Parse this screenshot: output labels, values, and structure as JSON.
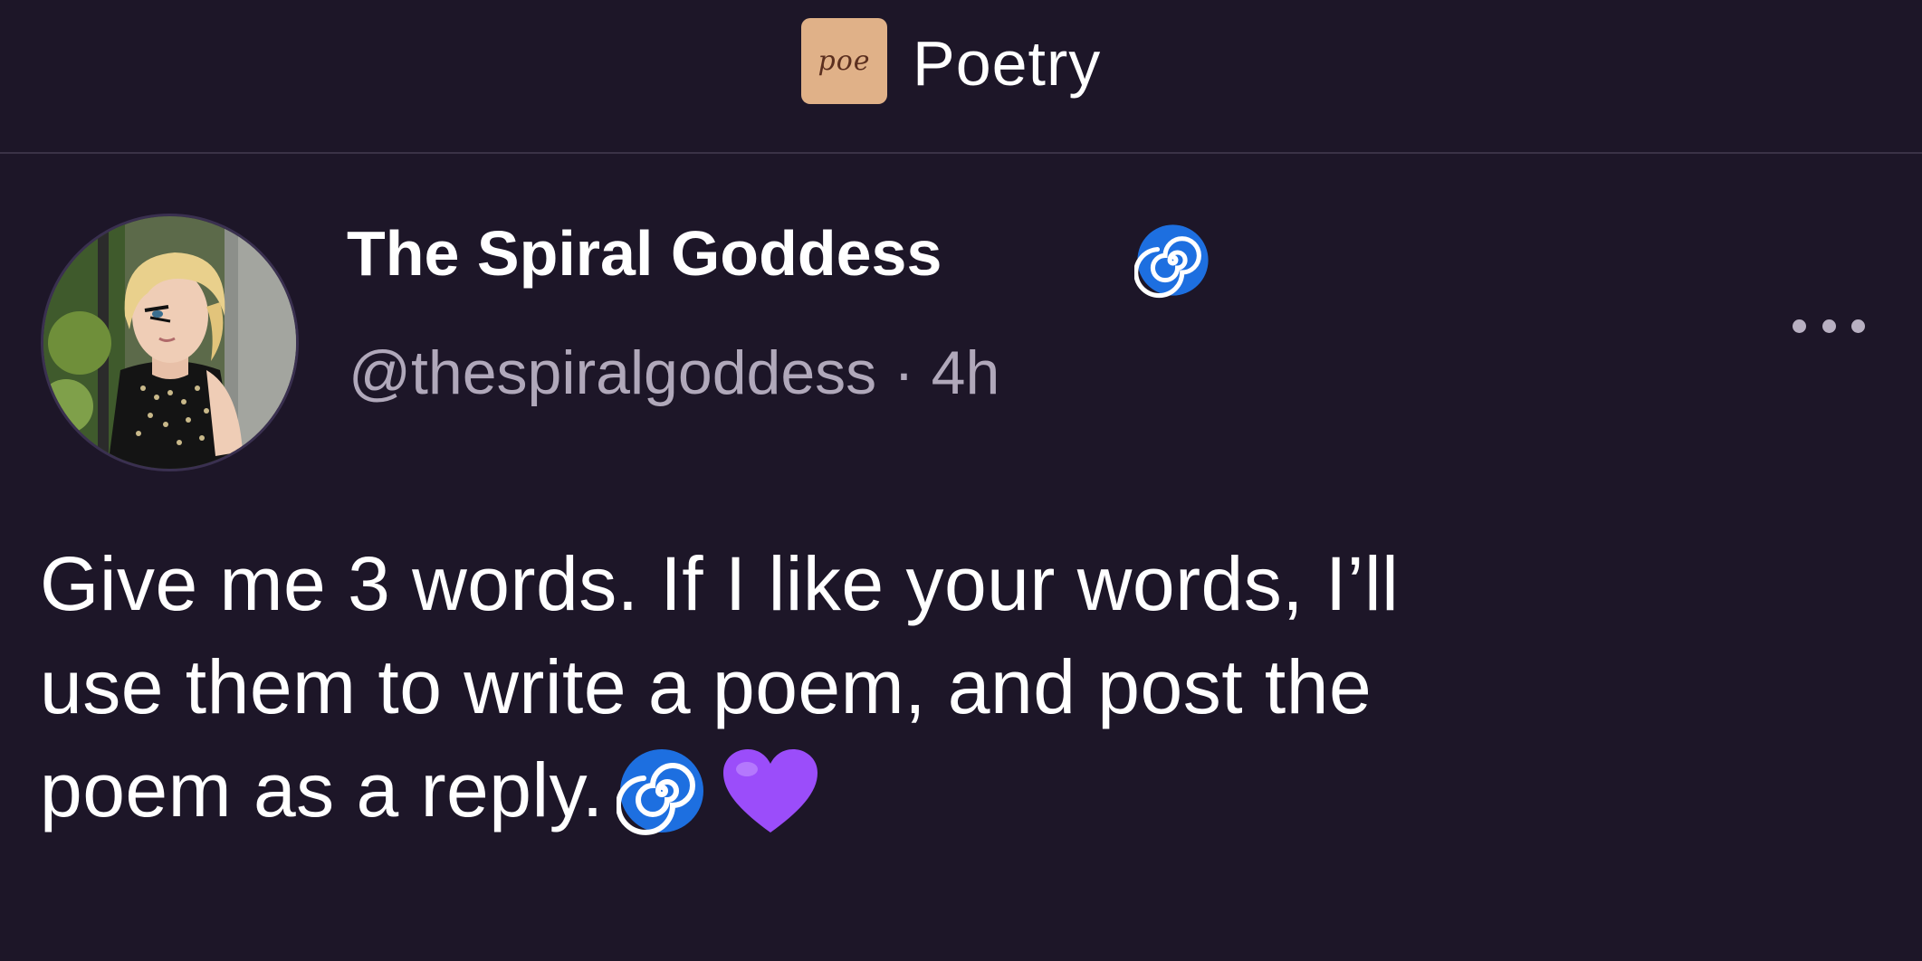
{
  "header": {
    "community_logo_text": "poe",
    "community_title": "Poetry",
    "logo_color": "#e0b188"
  },
  "post": {
    "author_name": "The Spiral Goddess",
    "author_emoji": "spiral-emoji",
    "handle": "@thespiralgoddess",
    "separator": "·",
    "time": "4h",
    "body_lines": [
      "Give me 3 words. If I like your words, I’ll",
      "use them to write a poem, and post the",
      "poem as a reply."
    ],
    "body_emojis": [
      "spiral-emoji",
      "purple-heart-emoji"
    ],
    "more_icon": "ellipsis-icon"
  },
  "colors": {
    "background": "#1d1628",
    "text": "#ffffff",
    "muted": "#b0a8ba",
    "spiral": "#1d6fe0",
    "heart": "#9b4dfa"
  }
}
